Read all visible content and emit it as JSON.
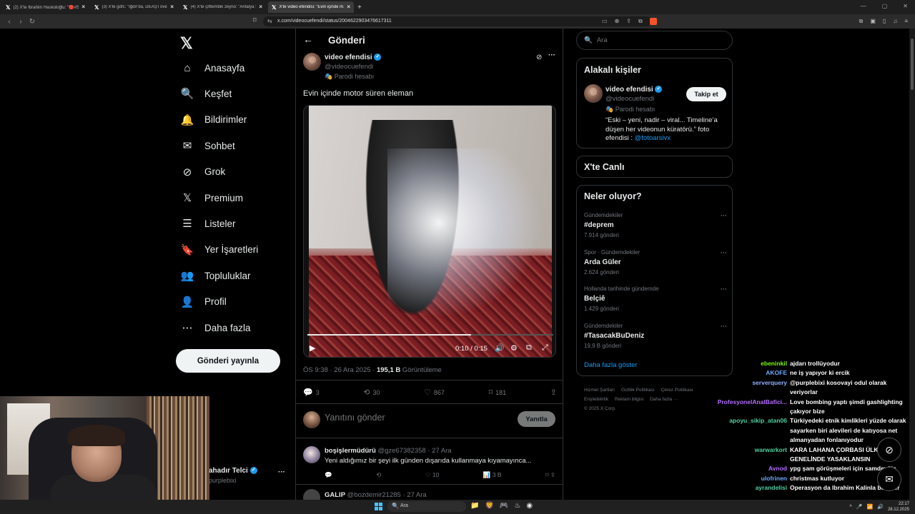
{
  "browser": {
    "tabs": [
      {
        "title": "(2) X'te İbrahim Haskoloğlu: \"🔴#SO...",
        "active": false
      },
      {
        "title": "(3) X'te gdfc: \"Iğdır'da, DEAŞ'ı öven v...",
        "active": false
      },
      {
        "title": "(4) X'te çiftlembik zeyno: \"Antalya Se...",
        "active": false
      },
      {
        "title": "X'te video efendisi: \"Evin içinde m...",
        "active": true
      }
    ],
    "url": "x.com/videocuefendi/status/2004622903476617311"
  },
  "sidebar": {
    "items": [
      {
        "label": "Anasayfa",
        "icon": "home-icon",
        "glyph": "⌂"
      },
      {
        "label": "Keşfet",
        "icon": "search-icon",
        "glyph": "🔍"
      },
      {
        "label": "Bildirimler",
        "icon": "bell-icon",
        "glyph": "🔔"
      },
      {
        "label": "Sohbet",
        "icon": "mail-icon",
        "glyph": "✉"
      },
      {
        "label": "Grok",
        "icon": "grok-icon",
        "glyph": "⊘"
      },
      {
        "label": "Premium",
        "icon": "x-premium-icon",
        "glyph": "𝕏"
      },
      {
        "label": "Listeler",
        "icon": "list-icon",
        "glyph": "☰"
      },
      {
        "label": "Yer İşaretleri",
        "icon": "bookmark-icon",
        "glyph": "🔖"
      },
      {
        "label": "Topluluklar",
        "icon": "communities-icon",
        "glyph": "👥"
      },
      {
        "label": "Profil",
        "icon": "profile-icon",
        "glyph": "👤"
      },
      {
        "label": "Daha fazla",
        "icon": "more-circle-icon",
        "glyph": "⋯"
      }
    ],
    "post_button": "Gönderi yayınla",
    "account": {
      "name": "ahadır Telci",
      "handle": "purplebixi"
    }
  },
  "post": {
    "header_title": "Gönderi",
    "author_name": "video efendisi",
    "author_handle": "@videocuefendi",
    "parody_label": "Parodi hesabı",
    "text": "Evin içinde motor süren eleman",
    "video": {
      "time": "0:10 / 0:15",
      "progress": 0.667
    },
    "timestamp": "ÖS 9:38 · 26 Ara 2025 · ",
    "views_count": "195,1 B",
    "views_label": " Görüntüleme",
    "stats": {
      "replies": "3",
      "reposts": "30",
      "likes": "867",
      "bookmarks": "181"
    },
    "reply_placeholder": "Yanıtını gönder",
    "reply_button": "Yanıtla"
  },
  "replies": [
    {
      "name": "boşişlermüdürü",
      "handle": "@gze67382358 · 27 Ara",
      "text": "Yeni aldığımız bir şeyi ilk günden dışarıda kullanmaya kıyamayınca...",
      "replies": "",
      "reposts": "",
      "likes": "10",
      "views": "3 B"
    },
    {
      "name": "GALIP",
      "handle": "@bozdemir21285 · 27 Ara"
    }
  ],
  "right": {
    "search_placeholder": "Ara",
    "related_title": "Alakalı kişiler",
    "related": {
      "name": "video efendisi",
      "handle": "@videocuefendi",
      "parody": "Parodi hesabı",
      "bio": "“Eski – yeni, nadir – viral... Timeline’a düşen her videonun küratörü.” foto efendisi : ",
      "bio_link": "@fotoarsivx",
      "follow": "Takip et"
    },
    "live_title": "X'te Canlı",
    "trends_title": "Neler oluyor?",
    "trends": [
      {
        "context": "Gündemdekiler",
        "name": "#deprem",
        "count": "7.914 gönderi"
      },
      {
        "context": "Spor · Gündemdekiler",
        "name": "Arda Güler",
        "count": "2.624 gönderi"
      },
      {
        "context": "Hollanda tarihinde gündemde",
        "name": "Belçiê",
        "count": "1.429 gönderi"
      },
      {
        "context": "Gündemdekiler",
        "name": "#TasacakBuDeniz",
        "count": "19,9 B gönderi"
      }
    ],
    "show_more": "Daha fazla göster",
    "footer": [
      "Hizmet Şartları",
      "Gizlilik Politikası",
      "Çerez Politikası",
      "Erişilebilirlik",
      "Reklam bilgisi",
      "Daha fazla ···",
      "© 2025 X Corp."
    ]
  },
  "chat": [
    {
      "user": "ebeninkil",
      "color": "#7cfc00",
      "msg": "ajdarı trollüyodur"
    },
    {
      "user": "AKOFE",
      "color": "#6fa8ff",
      "msg": "ne iş yapıyor ki ercik"
    },
    {
      "user": "serverquery",
      "color": "#8fb0ff",
      "msg": "@purplebixi kosovayi odul olarak veriyorlar"
    },
    {
      "user": "ProfesyonelAnalBafici...",
      "color": "#b26bff",
      "msg": "Love bombing yaptı şimdi gashlighting çakıyor bize"
    },
    {
      "user": "apoyu_sikip_atan06",
      "color": "#4fd0a0",
      "msg": "Türkiyedeki etnik kimlikleri yüzde olarak sayarken biri alevileri de katıyosa net almanyadan fonlanıyodur"
    },
    {
      "user": "warwarkort",
      "color": "#4fd0a0",
      "msg": "KARA LAHANA ÇORBASI ÜLKE GENELİNDE YASAKLANSIN"
    },
    {
      "user": "Avnod",
      "color": "#b26bff",
      "msg": "ypg şam görüşmeleri için samdeyöiş"
    },
    {
      "user": "ulofrinen",
      "color": "#6fa8ff",
      "msg": "christmas kutluyor"
    },
    {
      "user": "ayrandelisi",
      "color": "#4fd0a0",
      "msg": "Operasyon da Ibrahim Kalinla beraber"
    }
  ],
  "taskbar": {
    "search": "Ara",
    "time": "22:17",
    "date": "28.12.2025"
  }
}
